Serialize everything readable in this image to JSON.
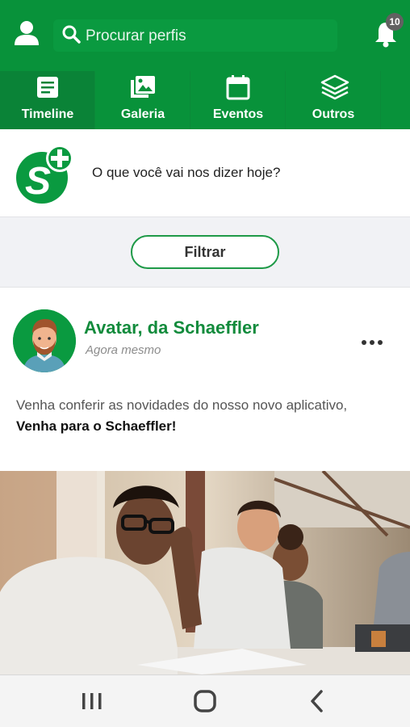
{
  "search": {
    "placeholder": "Procurar perfis"
  },
  "notifications": {
    "count": "10"
  },
  "tabs": [
    {
      "label": "Timeline",
      "icon": "article-icon",
      "active": true
    },
    {
      "label": "Galeria",
      "icon": "gallery-icon",
      "active": false
    },
    {
      "label": "Eventos",
      "icon": "calendar-icon",
      "active": false
    },
    {
      "label": "Outros",
      "icon": "layers-icon",
      "active": false
    }
  ],
  "composer": {
    "prompt": "O que você vai nos dizer hoje?",
    "logo_text": "S+"
  },
  "filter": {
    "label": "Filtrar"
  },
  "post": {
    "author": "Avatar, da Schaeffler",
    "time": "Agora mesmo",
    "text": "Venha conferir as novidades do nosso novo aplicativo,",
    "text_bold": "Venha para o Schaeffler!"
  },
  "colors": {
    "primary": "#08923a",
    "accent_text": "#128b3c",
    "background": "#f1f2f5"
  },
  "navbar": {
    "buttons": [
      "recent-apps-icon",
      "home-icon",
      "back-icon"
    ]
  }
}
